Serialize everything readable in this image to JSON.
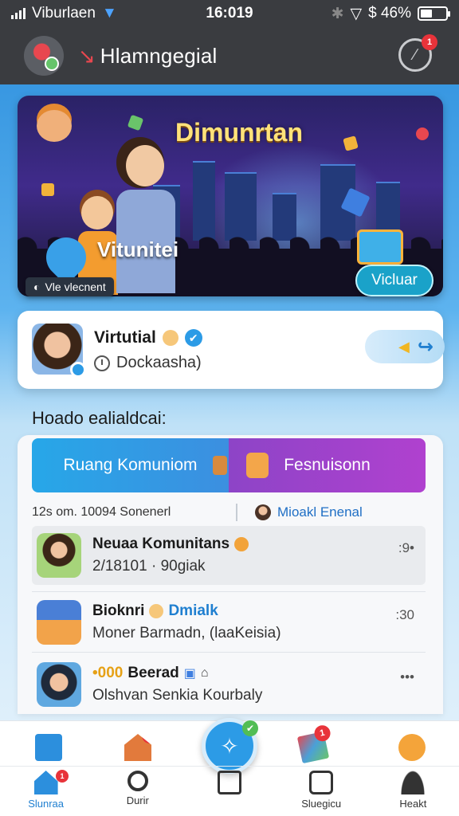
{
  "status_bar": {
    "carrier": "Viburlaen",
    "time": "16:019",
    "battery_text": "$ 46%",
    "battery_level": 0.46
  },
  "header": {
    "title": "Hlamngegial",
    "notification_count": "1"
  },
  "banner": {
    "title": "Dimunrtan",
    "subtitle": "Vitunitei",
    "tag": "Vle vlecnent",
    "button": "Vicluar"
  },
  "profile": {
    "name": "Virtutial",
    "status": "Dockaasha)"
  },
  "section_title": "Hoado ealialdcai:",
  "tabs": [
    {
      "label": "Ruang Komuniom"
    },
    {
      "label": "Fesnuisonn"
    }
  ],
  "meta": {
    "left": "12s om. 10094 Sonenerl",
    "right": "Mioakl Enenal"
  },
  "list": [
    {
      "title": "Neuaa Komunitans",
      "title_accent": "",
      "subtitle": "2/18101 · 90giak",
      "time": ":9•"
    },
    {
      "title": "Bioknri",
      "title_accent": "Dmialk",
      "subtitle": "Moner Barmadn, (laaKeisia)",
      "time": ":30"
    },
    {
      "title": "Beerad",
      "title_accent": "•000",
      "subtitle": "Olshvan Senkia Kourbaly",
      "time": "•••"
    }
  ],
  "bottom_nav": {
    "top_badges": [
      "1",
      "1"
    ],
    "items": [
      {
        "label": "Slunraa",
        "icon": "home-icon",
        "badge": "1"
      },
      {
        "label": "Durir",
        "icon": "search-icon",
        "badge": ""
      },
      {
        "label": "",
        "icon": "compose-icon",
        "badge": ""
      },
      {
        "label": "Sluegicu",
        "icon": "media-icon",
        "badge": ""
      },
      {
        "label": "Heakt",
        "icon": "user-icon",
        "badge": ""
      }
    ]
  },
  "colors": {
    "accent": "#2c9be6",
    "tab_left": "#27a7e8",
    "tab_right": "#b041cf",
    "badge": "#e8333a"
  }
}
